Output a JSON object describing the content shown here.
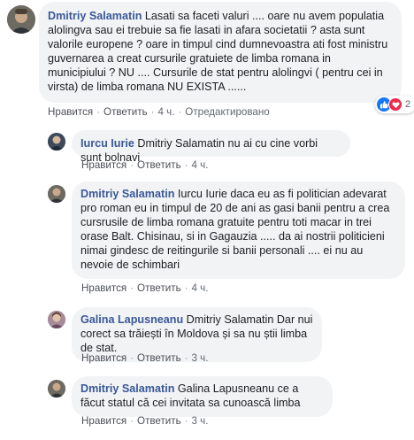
{
  "comments": [
    {
      "author": "Dmitriy Salamatin",
      "text": "Lasati sa faceti valuri .... oare nu avem populatia alolingva sau ei trebuie sa fie lasati in afara societatii ? asta sunt valorile europene ? oare in timpul cind dumnevoastra ati fost ministru guvernarea a creat cursurile gratuiete de limba romana in municipiului ? NU .... Cursurile de stat pentru alolingvi ( pentru cei in virsta) de limba romana NU EXISTA ......",
      "like": "Нравится",
      "reply": "Ответить",
      "time": "4 ч.",
      "edited": "Отредактировано",
      "reaction_count": "2"
    },
    {
      "author": "Iurcu Iurie",
      "text": "Dmitriy Salamatin nu ai cu cine vorbi sunt bolnavi",
      "like": "Нравится",
      "reply": "Ответить",
      "time": "4 ч."
    },
    {
      "author": "Dmitriy Salamatin",
      "text": "Iurcu Iurie daca eu as fi politician adevarat pro roman eu in timpul de 20 de ani as gasi banii pentru a crea cursrusile de limba romana gratuite pentru toti macar in trei orase Balt. Chisinau, si in Gagauzia ..... da ai nostrii politicieni nimai gindesc de reitingurile si banii personali .... ei nu au nevoie de schimbari",
      "like": "Нравится",
      "reply": "Ответить",
      "time": "4 ч."
    },
    {
      "author": "Galina Lapusneanu",
      "text": "Dmitriy Salamatin Dar nui corect sa trăiești în Moldova și sa nu știi limba de stat.",
      "like": "Нравится",
      "reply": "Ответить",
      "time": "3 ч."
    },
    {
      "author": "Dmitriy Salamatin",
      "text": "Galina Lapusneanu ce a făcut statul că cei invitata sa cunoască limba",
      "like": "Нравится",
      "reply": "Ответить",
      "time": "3 ч."
    }
  ],
  "colors": {
    "author": "#385898",
    "bubble": "#f2f3f5",
    "like_badge": "#1877f2",
    "heart_badge": "#f0284a"
  },
  "icons": [
    "avatar",
    "like-icon",
    "heart-icon"
  ]
}
